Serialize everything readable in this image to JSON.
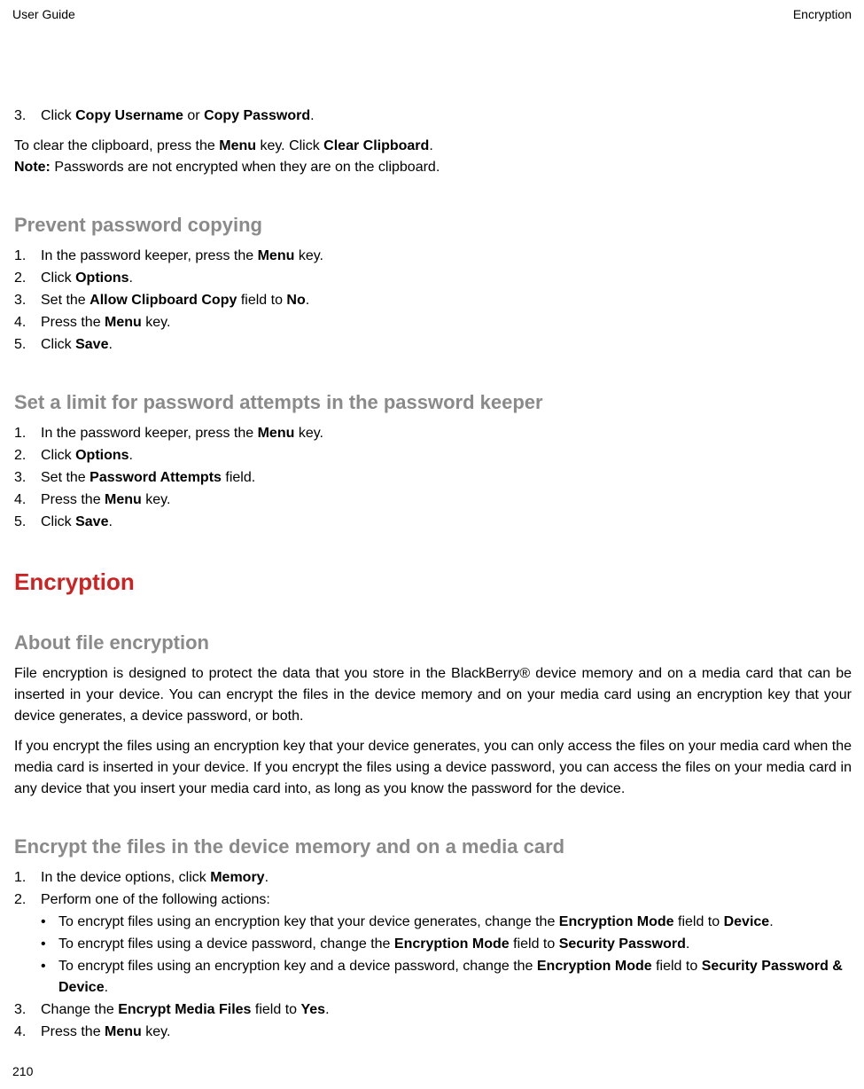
{
  "header": {
    "left": "User Guide",
    "right": "Encryption"
  },
  "intro_step": {
    "num": "3.",
    "pre": "Click ",
    "b1": "Copy Username",
    "mid": " or ",
    "b2": "Copy Password",
    "post": "."
  },
  "clipboard_para": {
    "pre": "To clear the clipboard, press the ",
    "b1": "Menu",
    "mid": " key. Click ",
    "b2": "Clear Clipboard",
    "post": "."
  },
  "note_line": {
    "label": "Note:",
    "text": "  Passwords are not encrypted when they are on the clipboard."
  },
  "sec1": {
    "title": "Prevent password copying",
    "steps": [
      {
        "num": "1.",
        "pre": "In the password keeper, press the ",
        "b1": "Menu",
        "post": " key."
      },
      {
        "num": "2.",
        "pre": "Click ",
        "b1": "Options",
        "post": "."
      },
      {
        "num": "3.",
        "pre": "Set the ",
        "b1": "Allow Clipboard Copy",
        "mid": " field to ",
        "b2": "No",
        "post": "."
      },
      {
        "num": "4.",
        "pre": "Press the ",
        "b1": "Menu",
        "post": " key."
      },
      {
        "num": "5.",
        "pre": "Click ",
        "b1": "Save",
        "post": "."
      }
    ]
  },
  "sec2": {
    "title": "Set a limit for password attempts in the password keeper",
    "steps": [
      {
        "num": "1.",
        "pre": "In the password keeper, press the ",
        "b1": "Menu",
        "post": " key."
      },
      {
        "num": "2.",
        "pre": "Click ",
        "b1": "Options",
        "post": "."
      },
      {
        "num": "3.",
        "pre": "Set the ",
        "b1": "Password Attempts",
        "post": " field."
      },
      {
        "num": "4.",
        "pre": "Press the ",
        "b1": "Menu",
        "post": " key."
      },
      {
        "num": "5.",
        "pre": "Click ",
        "b1": "Save",
        "post": "."
      }
    ]
  },
  "enc_title": "Encryption",
  "sec3": {
    "title": "About file encryption",
    "p1": "File encryption is designed to protect the data that you store in the BlackBerry® device memory and on a media card that can be inserted in your device. You can encrypt the files in the device memory and on your media card using an encryption key that your device generates, a device password, or both.",
    "p2": "If you encrypt the files using an encryption key that your device generates, you can only access the files on your media card when the media card is inserted in your device. If you encrypt the files using a device password, you can access the files on your media card in any device that you insert your media card into, as long as you know the password for the device."
  },
  "sec4": {
    "title": "Encrypt the files in the device memory and on a media card",
    "step1": {
      "num": "1.",
      "pre": "In the device options, click ",
      "b1": "Memory",
      "post": "."
    },
    "step2": {
      "num": "2.",
      "text": "Perform one of the following actions:"
    },
    "bullets": [
      {
        "pre": "To encrypt files using an encryption key that your device generates, change the ",
        "b1": "Encryption Mode",
        "mid": " field to ",
        "b2": "Device",
        "post": "."
      },
      {
        "pre": "To encrypt files using a device password, change the ",
        "b1": "Encryption Mode",
        "mid": " field to ",
        "b2": "Security Password",
        "post": "."
      },
      {
        "pre": "To encrypt files using an encryption key and a device password, change the ",
        "b1": "Encryption Mode",
        "mid": " field to ",
        "b2": "Security Password & Device",
        "post": "."
      }
    ],
    "step3": {
      "num": "3.",
      "pre": "Change the ",
      "b1": "Encrypt Media Files",
      "mid": " field to ",
      "b2": "Yes",
      "post": "."
    },
    "step4": {
      "num": "4.",
      "pre": "Press the ",
      "b1": "Menu",
      "post": " key."
    }
  },
  "page_number": "210"
}
